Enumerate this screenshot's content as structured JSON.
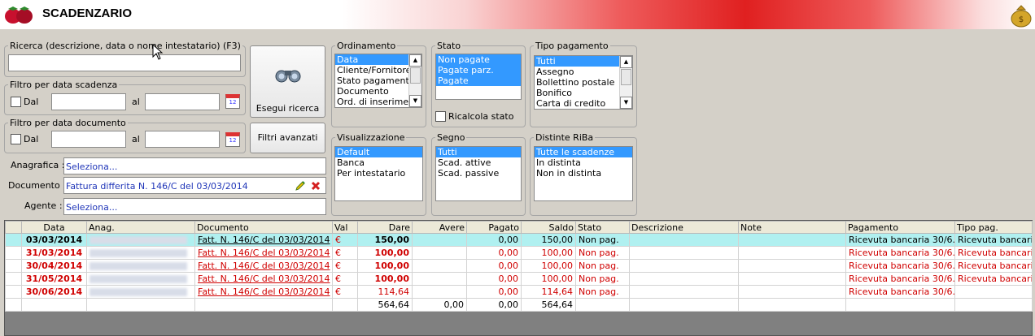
{
  "header": {
    "title": "SCADENZARIO"
  },
  "search": {
    "legend": "Ricerca (descrizione, data o nome intestatario) (F3)",
    "value": ""
  },
  "filtro_scadenza": {
    "legend": "Filtro per data scadenza",
    "dal_label": "Dal",
    "al_label": "al",
    "calendar_icon_text": "12"
  },
  "filtro_documento": {
    "legend": "Filtro per data documento",
    "dal_label": "Dal",
    "al_label": "al",
    "calendar_icon_text": "12"
  },
  "buttons": {
    "esegui": "Esegui ricerca",
    "filtri": "Filtri avanzati"
  },
  "anagrafica": {
    "label": "Anagrafica :",
    "value": "Seleziona..."
  },
  "documento": {
    "label": "Documento :",
    "value": "Fattura differita N. 146/C del 03/03/2014"
  },
  "agente": {
    "label": "Agente :",
    "value": "Seleziona..."
  },
  "ordinamento": {
    "legend": "Ordinamento",
    "options": [
      "Data",
      "Cliente/Fornitore",
      "Stato pagamento",
      "Documento",
      "Ord. di inserimento"
    ],
    "selected": "Data"
  },
  "stato": {
    "legend": "Stato",
    "options": [
      "Non pagate",
      "Pagate parz.",
      "Pagate"
    ],
    "ricalcola": "Ricalcola stato"
  },
  "tipo_pagamento": {
    "legend": "Tipo pagamento",
    "options": [
      "Tutti",
      "Assegno",
      "Bollettino postale",
      "Bonifico",
      "Carta di credito"
    ],
    "selected": "Tutti"
  },
  "visualizzazione": {
    "legend": "Visualizzazione",
    "options": [
      "Default",
      "Banca",
      "Per intestatario"
    ],
    "selected": "Default"
  },
  "segno": {
    "legend": "Segno",
    "options": [
      "Tutti",
      "Scad. attive",
      "Scad. passive"
    ],
    "selected": "Tutti"
  },
  "distinte": {
    "legend": "Distinte RiBa",
    "options": [
      "Tutte le scadenze",
      "In distinta",
      "Non in distinta"
    ],
    "selected": "Tutte le scadenze"
  },
  "table": {
    "columns": [
      "",
      "Data",
      "Anag.",
      "Documento",
      "Val",
      "Dare",
      "Avere",
      "Pagato",
      "Saldo",
      "Stato",
      "Descrizione",
      "Note",
      "Pagamento",
      "Tipo pag."
    ],
    "rows": [
      {
        "data": "03/03/2014",
        "documento": "Fatt. N. 146/C del 03/03/2014",
        "val": "€",
        "dare": "150,00",
        "avere": "",
        "pagato": "0,00",
        "saldo": "150,00",
        "stato": "Non pag.",
        "pagamento": "Ricevuta bancaria 30/6...",
        "tipo": "Ricevuta bancaria"
      },
      {
        "data": "31/03/2014",
        "documento": "Fatt. N. 146/C del 03/03/2014",
        "val": "€",
        "dare": "100,00",
        "avere": "",
        "pagato": "0,00",
        "saldo": "100,00",
        "stato": "Non pag.",
        "pagamento": "Ricevuta bancaria 30/6...",
        "tipo": "Ricevuta bancaria"
      },
      {
        "data": "30/04/2014",
        "documento": "Fatt. N. 146/C del 03/03/2014",
        "val": "€",
        "dare": "100,00",
        "avere": "",
        "pagato": "0,00",
        "saldo": "100,00",
        "stato": "Non pag.",
        "pagamento": "Ricevuta bancaria 30/6...",
        "tipo": "Ricevuta bancaria"
      },
      {
        "data": "31/05/2014",
        "documento": "Fatt. N. 146/C del 03/03/2014",
        "val": "€",
        "dare": "100,00",
        "avere": "",
        "pagato": "0,00",
        "saldo": "100,00",
        "stato": "Non pag.",
        "pagamento": "Ricevuta bancaria 30/6...",
        "tipo": "Ricevuta bancaria"
      },
      {
        "data": "30/06/2014",
        "documento": "Fatt. N. 146/C del 03/03/2014",
        "val": "€",
        "dare": "114,64",
        "avere": "",
        "pagato": "0,00",
        "saldo": "114,64",
        "stato": "Non pag.",
        "pagamento": "Ricevuta bancaria 30/6...",
        "tipo": ""
      }
    ],
    "totals": {
      "dare": "564,64",
      "avere": "0,00",
      "pagato": "0,00",
      "saldo": "564,64"
    }
  }
}
